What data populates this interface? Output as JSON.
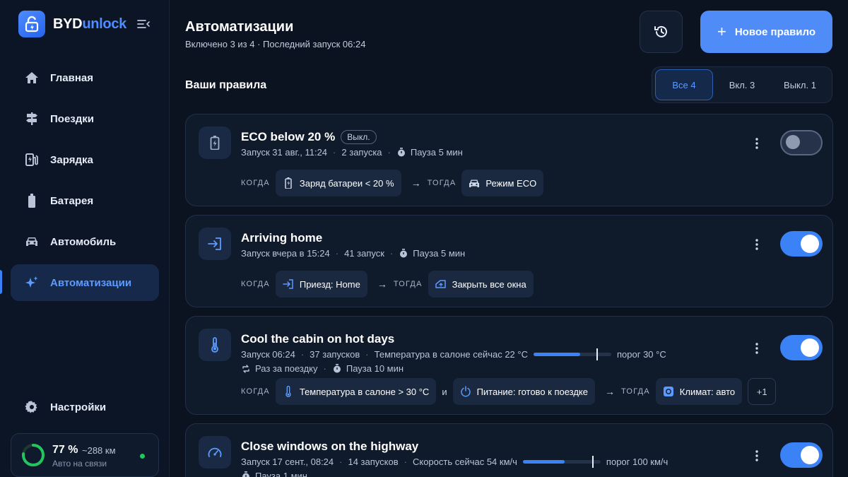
{
  "brand": {
    "part1": "BYD",
    "part2": "unlock"
  },
  "nav": [
    {
      "label": "Главная",
      "icon": "home-icon"
    },
    {
      "label": "Поездки",
      "icon": "signpost-icon"
    },
    {
      "label": "Зарядка",
      "icon": "ev-station-icon"
    },
    {
      "label": "Батарея",
      "icon": "battery-icon"
    },
    {
      "label": "Автомобиль",
      "icon": "car-icon"
    },
    {
      "label": "Автоматизации",
      "icon": "sparkle-icon",
      "active": true
    }
  ],
  "settings": {
    "label": "Настройки",
    "icon": "gear-icon"
  },
  "status": {
    "percent": "77 %",
    "range": "~288 км",
    "subtitle": "Авто на связи",
    "charge_fraction": 0.77
  },
  "header": {
    "title": "Автоматизации",
    "subtitle": "Включено 3 из 4 · Последний запуск 06:24",
    "new_rule_label": "Новое правило"
  },
  "section": {
    "title": "Ваши правила"
  },
  "filters": [
    {
      "label": "Все 4",
      "active": true
    },
    {
      "label": "Вкл. 3"
    },
    {
      "label": "Выкл. 1"
    }
  ],
  "colors": {
    "accent": "#3b82f6",
    "background": "#0b1220",
    "card": "#0f1a2b",
    "online": "#22c55e"
  },
  "keywords": {
    "when": "КОГДА",
    "then": "ТОГДА"
  },
  "rules": [
    {
      "title": "ECO below 20 %",
      "badge": "Выкл.",
      "enabled": false,
      "icon": "battery-icon",
      "meta": {
        "run": "Запуск 31 авг., 11:24",
        "count": "2 запуска",
        "pause": "Пауза 5 мин"
      },
      "conditions": [
        {
          "label": "Заряд батареи < 20 %",
          "icon": "battery-icon"
        }
      ],
      "actions": [
        {
          "label": "Режим ECO",
          "icon": "car-icon"
        }
      ]
    },
    {
      "title": "Arriving home",
      "enabled": true,
      "icon": "login-icon",
      "meta": {
        "run": "Запуск вчера в 15:24",
        "count": "41 запуск",
        "pause": "Пауза 5 мин"
      },
      "conditions": [
        {
          "label": "Приезд: Home",
          "icon": "login-icon"
        }
      ],
      "actions": [
        {
          "label": "Закрыть все окна",
          "icon": "window-icon"
        }
      ]
    },
    {
      "title": "Cool the cabin on hot days",
      "enabled": true,
      "icon": "thermometer-icon",
      "meta": {
        "run": "Запуск 06:24",
        "count": "37 запусков",
        "sensor": "Температура в салоне сейчас 22 °C",
        "threshold": "порог 30 °C",
        "progress_fraction": 0.6,
        "threshold_fraction": 0.82,
        "frequency": "Раз за поездку",
        "pause": "Пауза 10 мин"
      },
      "conditions": [
        {
          "label": "Температура в салоне > 30 °C",
          "icon": "thermometer-icon"
        },
        {
          "label": "Питание: готово к поездке",
          "icon": "power-icon"
        }
      ],
      "conjunction": "и",
      "actions": [
        {
          "label": "Климат: авто",
          "icon": "climate-icon"
        }
      ],
      "more": "+1"
    },
    {
      "title": "Close windows on the highway",
      "enabled": true,
      "icon": "speedometer-icon",
      "meta": {
        "run": "Запуск 17 сент., 08:24",
        "count": "14 запусков",
        "sensor": "Скорость сейчас 54 км/ч",
        "threshold": "порог 100 км/ч",
        "progress_fraction": 0.54,
        "threshold_fraction": 0.9,
        "pause": "Пауза 1 мин"
      }
    }
  ]
}
